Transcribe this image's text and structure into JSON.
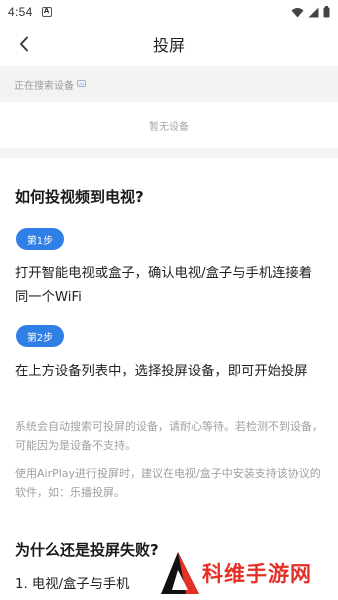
{
  "status_bar": {
    "time": "4:54",
    "app_badge": "A"
  },
  "header": {
    "title": "投屏"
  },
  "search_bar": {
    "text": "正在搜索设备"
  },
  "device_list": {
    "empty_text": "暂无设备"
  },
  "guide": {
    "title": "如何投视频到电视?",
    "steps": [
      {
        "badge": "第1步",
        "text": "打开智能电视或盒子，确认电视/盒子与手机连接着同一个WiFi"
      },
      {
        "badge": "第2步",
        "text": "在上方设备列表中，选择投屏设备，即可开始投屏"
      }
    ],
    "notes": [
      "系统会自动搜索可投屏的设备，请耐心等待。若检测不到设备，可能因为是设备不支持。",
      "使用AirPlay进行投屏时，建议在电视/盒子中安装支持该协议的软件，如：乐播投屏。"
    ]
  },
  "failure": {
    "title": "为什么还是投屏失败?",
    "item1": "1. 电视/盒子与手机"
  },
  "watermark": {
    "text": "科维手游网"
  },
  "colors": {
    "accent": "#2f7fe7",
    "watermark": "#e53027"
  }
}
